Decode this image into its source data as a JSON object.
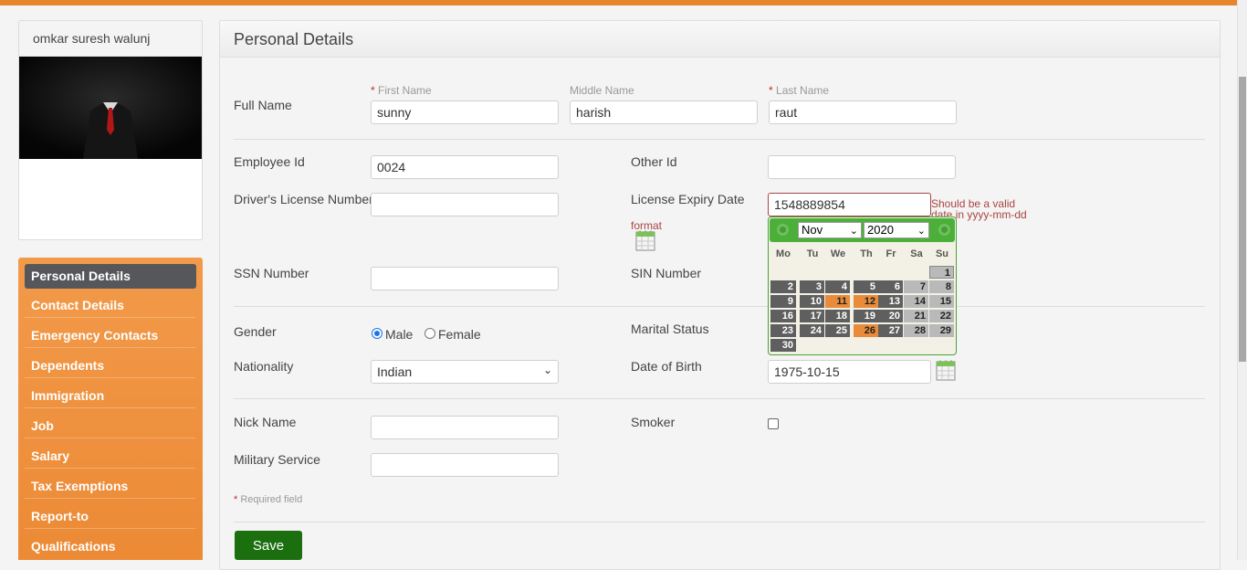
{
  "profile": {
    "name": "omkar suresh walunj"
  },
  "nav": [
    "Personal Details",
    "Contact Details",
    "Emergency Contacts",
    "Dependents",
    "Immigration",
    "Job",
    "Salary",
    "Tax Exemptions",
    "Report-to",
    "Qualifications"
  ],
  "page": {
    "title": "Personal Details"
  },
  "form": {
    "full_name_label": "Full Name",
    "first_name_label": "First Name",
    "middle_name_label": "Middle Name",
    "last_name_label": "Last Name",
    "required_star": "*",
    "first_name": "sunny",
    "middle_name": "harish",
    "last_name": "raut",
    "employee_id_label": "Employee Id",
    "employee_id": "0024",
    "other_id_label": "Other Id",
    "other_id": "",
    "drivers_license_label": "Driver's License Number",
    "drivers_license": "",
    "license_expiry_label": "License Expiry Date",
    "license_expiry": "1548889854",
    "license_expiry_error_1": "Should be a valid",
    "license_expiry_error_2": "date in yyyy-mm-dd",
    "license_expiry_error_3": "format",
    "ssn_label": "SSN Number",
    "ssn": "",
    "sin_label": "SIN Number",
    "gender_label": "Gender",
    "gender_male": "Male",
    "gender_female": "Female",
    "gender_selected": "Male",
    "marital_label": "Marital Status",
    "nationality_label": "Nationality",
    "nationality": "Indian",
    "dob_label": "Date of Birth",
    "dob": "1975-10-15",
    "nick_label": "Nick Name",
    "nick": "",
    "smoker_label": "Smoker",
    "smoker_checked": false,
    "military_label": "Military Service",
    "military": "",
    "required_note": "Required field",
    "save_label": "Save"
  },
  "datepicker": {
    "month": "Nov",
    "year": "2020",
    "weekdays": [
      "Mo",
      "Tu",
      "We",
      "Th",
      "Fr",
      "Sa",
      "Su"
    ],
    "highlighted_days": [
      "11",
      "12",
      "26"
    ],
    "rows": [
      [
        "",
        "",
        "",
        "",
        "",
        "",
        "1"
      ],
      [
        "2",
        "3",
        "4",
        "5",
        "6",
        "7",
        "8"
      ],
      [
        "9",
        "10",
        "11",
        "12",
        "13",
        "14",
        "15"
      ],
      [
        "16",
        "17",
        "18",
        "19",
        "20",
        "21",
        "22"
      ],
      [
        "23",
        "24",
        "25",
        "26",
        "27",
        "28",
        "29"
      ],
      [
        "30",
        "",
        "",
        "",
        "",
        "",
        ""
      ]
    ]
  },
  "colors": {
    "accent": "#e8832e",
    "nav_active": "#56575a",
    "save": "#1b6f0f",
    "error": "#a94442",
    "datepicker_header": "#4caf3a"
  }
}
